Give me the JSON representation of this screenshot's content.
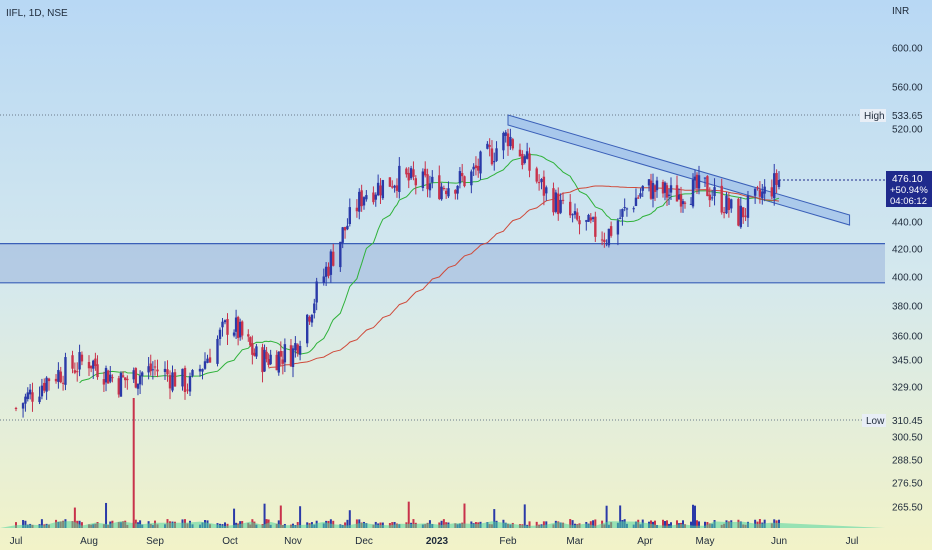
{
  "header": {
    "symbol": "IIFL, 1D, NSE",
    "currency": "INR"
  },
  "colors": {
    "up": "#2a3aa8",
    "down": "#c8324b",
    "ma_short": "#2fb23a",
    "ma_long": "#cf4a3a",
    "zone_fill": "#8fa8d8",
    "trend_fill": "#8fb4e8",
    "price_badge": "#1f2a8c",
    "volume_area": "#4fd6a0"
  },
  "price_axis": {
    "ticks": [
      "600.00",
      "560.00",
      "520.00",
      "440.00",
      "420.00",
      "400.00",
      "380.00",
      "360.00",
      "345.00",
      "329.00",
      "300.50",
      "288.50",
      "276.50",
      "265.50"
    ]
  },
  "markers": {
    "high": {
      "label": "High",
      "value": "533.65"
    },
    "low": {
      "label": "Low",
      "value": "310.45"
    },
    "current": {
      "price": "476.10",
      "change": "+50.94%",
      "countdown": "04:06:12"
    }
  },
  "time_axis": {
    "ticks": [
      "Jul",
      "Aug",
      "Sep",
      "Oct",
      "Nov",
      "Dec",
      "2023",
      "Feb",
      "Mar",
      "Apr",
      "May",
      "Jun",
      "Jul"
    ]
  },
  "chart_data": {
    "type": "line",
    "symbol": "IIFL",
    "interval": "1D",
    "exchange": "NSE",
    "currency": "INR",
    "x": [
      "2022-07-01",
      "2022-07-15",
      "2022-08-01",
      "2022-08-15",
      "2022-09-01",
      "2022-09-15",
      "2022-10-01",
      "2022-10-15",
      "2022-11-01",
      "2022-11-15",
      "2022-12-01",
      "2022-12-15",
      "2023-01-01",
      "2023-01-15",
      "2023-02-01",
      "2023-02-15",
      "2023-03-01",
      "2023-03-15",
      "2023-04-01",
      "2023-04-15",
      "2023-05-01",
      "2023-05-15",
      "2023-06-01"
    ],
    "series": [
      {
        "values": [
          317,
          335,
          345,
          332,
          340,
          330,
          370,
          345,
          350,
          405,
          465,
          478,
          470,
          478,
          515,
          470,
          440,
          430,
          470,
          463,
          470,
          445,
          476
        ]
      }
    ],
    "support_zone": [
      396,
      424
    ],
    "trendline": [
      [
        "2023-02-01",
        533.65
      ],
      [
        "2023-06-30",
        446
      ]
    ],
    "high": 533.65,
    "low": 310.45,
    "last": 476.1,
    "change_pct": 50.94,
    "ylim": [
      260,
      620
    ]
  }
}
